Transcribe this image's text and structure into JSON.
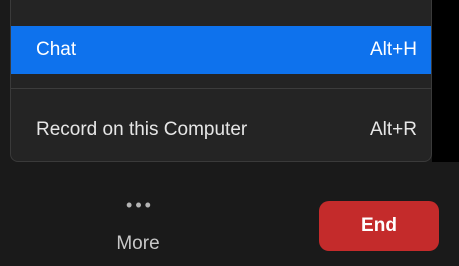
{
  "menu": {
    "items": [
      {
        "label": "Chat",
        "shortcut": "Alt+H",
        "highlighted": true
      },
      {
        "label": "Record on this Computer",
        "shortcut": "Alt+R",
        "highlighted": false
      }
    ]
  },
  "toolbar": {
    "more_label": "More",
    "more_icon": "more-dots-icon",
    "end_label": "End"
  },
  "colors": {
    "highlight": "#0e72ed",
    "end_button": "#c42b2b",
    "menu_background": "#242424",
    "toolbar_background": "#1a1a1a"
  }
}
